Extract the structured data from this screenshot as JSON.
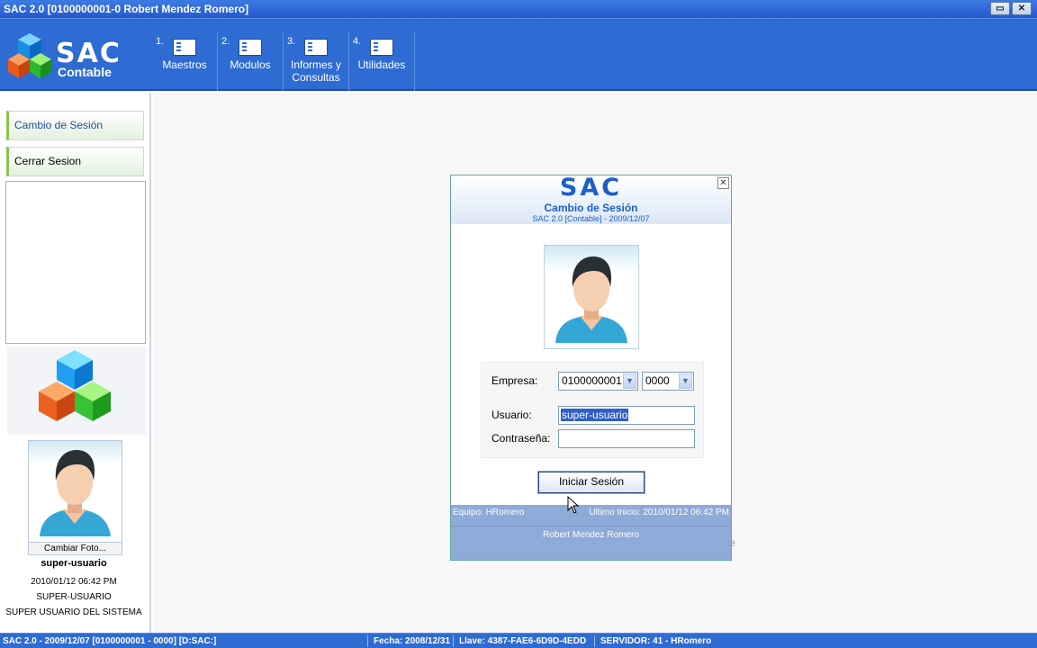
{
  "window": {
    "title": "SAC 2.0 [0100000001-0  Robert Mendez Romero]",
    "controls": {
      "minimize": "▭",
      "close": "✕"
    }
  },
  "logo": {
    "name": "SAC",
    "sub": "Contable"
  },
  "menu": [
    {
      "num": "1.",
      "label": "Maestros"
    },
    {
      "num": "2.",
      "label": "Modulos"
    },
    {
      "num": "3.",
      "label": "Informes y Consultas"
    },
    {
      "num": "4.",
      "label": "Utilidades"
    }
  ],
  "sidebar": {
    "items": [
      {
        "label": "Cambio de Sesión"
      },
      {
        "label": "Cerrar Sesion"
      }
    ],
    "photo_button": "Cambiar Foto...",
    "user": "super-usuario",
    "last_login": "2010/01/12 06:42 PM",
    "role": "SUPER-USUARIO",
    "description": "SUPER USUARIO DEL SISTEMA"
  },
  "dialog": {
    "brand": "SAC",
    "title": "Cambio de Sesión",
    "subtitle": "SAC 2.0 [Contable] - 2009/12/07",
    "close": "✕",
    "company_label": "Empresa:",
    "company_value": "0100000001",
    "branch_value": "0000",
    "user_label": "Usuario:",
    "user_value": "super-usuario",
    "password_label": "Contraseña:",
    "password_value": "",
    "login_button": "Iniciar Sesión",
    "footer_left": "Equipo: HRomero",
    "footer_right": "Ultimo Inicio: 2010/01/12 06:42 PM",
    "footer_name": "Robert Mendez Romero"
  },
  "main": {
    "stray_char": "e"
  },
  "statusbar": {
    "app": "SAC 2.0 - 2009/12/07 [0100000001 - 0000] [D:SAC:]",
    "date": "Fecha: 2008/12/31",
    "key": "Llave: 4387-FAE6-6D9D-4EDD",
    "server": "SERVIDOR: 41 - HRomero"
  },
  "colors": {
    "toolbar": "#2e6bd2",
    "accent": "#1c5fc6",
    "nav_highlight": "#8bc34a",
    "dialog_footer": "#8eaad8"
  }
}
